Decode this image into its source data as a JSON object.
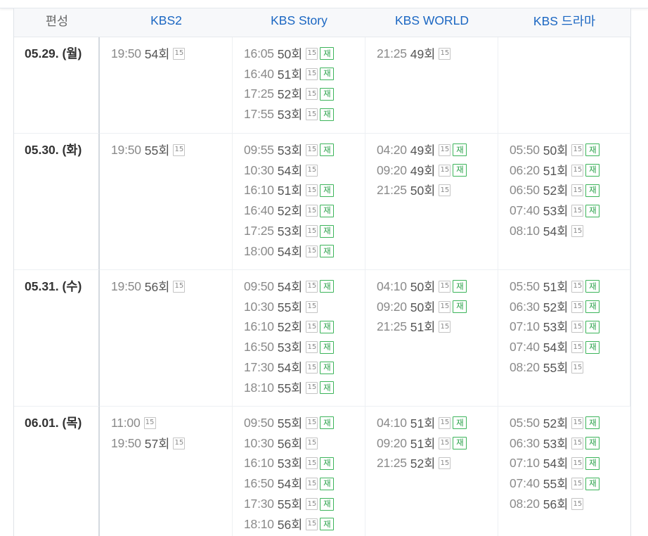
{
  "header": {
    "corner_label": "편성",
    "channels": [
      "KBS2",
      "KBS Story",
      "KBS WORLD",
      "KBS 드라마"
    ]
  },
  "labels": {
    "rating": "15",
    "rerun": "재",
    "episode_suffix": "회"
  },
  "colors": {
    "channel_link": "#1a66c2",
    "rerun_badge": "#2aa14a",
    "rating_badge": "#8a8a8a"
  },
  "days": [
    {
      "date": "05.29. (월)",
      "channels": [
        [
          {
            "time": "19:50",
            "ep": "54회",
            "rerun": false
          }
        ],
        [
          {
            "time": "16:05",
            "ep": "50회",
            "rerun": true
          },
          {
            "time": "16:40",
            "ep": "51회",
            "rerun": true
          },
          {
            "time": "17:25",
            "ep": "52회",
            "rerun": true
          },
          {
            "time": "17:55",
            "ep": "53회",
            "rerun": true
          }
        ],
        [
          {
            "time": "21:25",
            "ep": "49회",
            "rerun": false
          }
        ],
        []
      ]
    },
    {
      "date": "05.30. (화)",
      "channels": [
        [
          {
            "time": "19:50",
            "ep": "55회",
            "rerun": false
          }
        ],
        [
          {
            "time": "09:55",
            "ep": "53회",
            "rerun": true
          },
          {
            "time": "10:30",
            "ep": "54회",
            "rerun": false
          },
          {
            "time": "16:10",
            "ep": "51회",
            "rerun": true
          },
          {
            "time": "16:40",
            "ep": "52회",
            "rerun": true
          },
          {
            "time": "17:25",
            "ep": "53회",
            "rerun": true
          },
          {
            "time": "18:00",
            "ep": "54회",
            "rerun": true
          }
        ],
        [
          {
            "time": "04:20",
            "ep": "49회",
            "rerun": true
          },
          {
            "time": "09:20",
            "ep": "49회",
            "rerun": true
          },
          {
            "time": "21:25",
            "ep": "50회",
            "rerun": false
          }
        ],
        [
          {
            "time": "05:50",
            "ep": "50회",
            "rerun": true
          },
          {
            "time": "06:20",
            "ep": "51회",
            "rerun": true
          },
          {
            "time": "06:50",
            "ep": "52회",
            "rerun": true
          },
          {
            "time": "07:40",
            "ep": "53회",
            "rerun": true
          },
          {
            "time": "08:10",
            "ep": "54회",
            "rerun": false
          }
        ]
      ]
    },
    {
      "date": "05.31. (수)",
      "channels": [
        [
          {
            "time": "19:50",
            "ep": "56회",
            "rerun": false
          }
        ],
        [
          {
            "time": "09:50",
            "ep": "54회",
            "rerun": true
          },
          {
            "time": "10:30",
            "ep": "55회",
            "rerun": false
          },
          {
            "time": "16:10",
            "ep": "52회",
            "rerun": true
          },
          {
            "time": "16:50",
            "ep": "53회",
            "rerun": true
          },
          {
            "time": "17:30",
            "ep": "54회",
            "rerun": true
          },
          {
            "time": "18:10",
            "ep": "55회",
            "rerun": true
          }
        ],
        [
          {
            "time": "04:10",
            "ep": "50회",
            "rerun": true
          },
          {
            "time": "09:20",
            "ep": "50회",
            "rerun": true
          },
          {
            "time": "21:25",
            "ep": "51회",
            "rerun": false
          }
        ],
        [
          {
            "time": "05:50",
            "ep": "51회",
            "rerun": true
          },
          {
            "time": "06:30",
            "ep": "52회",
            "rerun": true
          },
          {
            "time": "07:10",
            "ep": "53회",
            "rerun": true
          },
          {
            "time": "07:40",
            "ep": "54회",
            "rerun": true
          },
          {
            "time": "08:20",
            "ep": "55회",
            "rerun": false
          }
        ]
      ]
    },
    {
      "date": "06.01. (목)",
      "channels": [
        [
          {
            "time": "11:00",
            "ep": "",
            "rerun": false
          },
          {
            "time": "19:50",
            "ep": "57회",
            "rerun": false
          }
        ],
        [
          {
            "time": "09:50",
            "ep": "55회",
            "rerun": true
          },
          {
            "time": "10:30",
            "ep": "56회",
            "rerun": false
          },
          {
            "time": "16:10",
            "ep": "53회",
            "rerun": true
          },
          {
            "time": "16:50",
            "ep": "54회",
            "rerun": true
          },
          {
            "time": "17:30",
            "ep": "55회",
            "rerun": true
          },
          {
            "time": "18:10",
            "ep": "56회",
            "rerun": true
          }
        ],
        [
          {
            "time": "04:10",
            "ep": "51회",
            "rerun": true
          },
          {
            "time": "09:20",
            "ep": "51회",
            "rerun": true
          },
          {
            "time": "21:25",
            "ep": "52회",
            "rerun": false
          }
        ],
        [
          {
            "time": "05:50",
            "ep": "52회",
            "rerun": true
          },
          {
            "time": "06:30",
            "ep": "53회",
            "rerun": true
          },
          {
            "time": "07:10",
            "ep": "54회",
            "rerun": true
          },
          {
            "time": "07:40",
            "ep": "55회",
            "rerun": true
          },
          {
            "time": "08:20",
            "ep": "56회",
            "rerun": false
          }
        ]
      ]
    }
  ]
}
